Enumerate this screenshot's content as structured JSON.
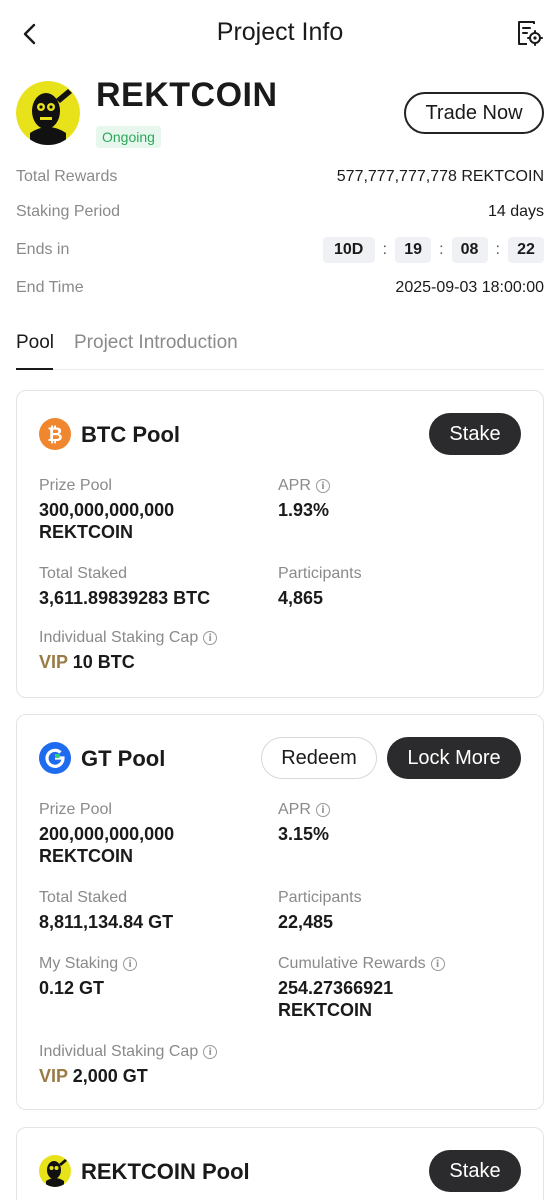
{
  "header": {
    "title": "Project Info"
  },
  "project": {
    "name": "REKTCOIN",
    "status": "Ongoing",
    "trade_button": "Trade Now"
  },
  "info": {
    "total_rewards": {
      "label": "Total Rewards",
      "value": "577,777,777,778 REKTCOIN"
    },
    "staking_period": {
      "label": "Staking Period",
      "value": "14 days"
    },
    "ends_in": {
      "label": "Ends in",
      "days": "10D",
      "hours": "19",
      "minutes": "08",
      "seconds": "22",
      "separator": ":"
    },
    "end_time": {
      "label": "End Time",
      "value": "2025-09-03 18:00:00"
    }
  },
  "tabs": [
    {
      "label": "Pool"
    },
    {
      "label": "Project Introduction"
    }
  ],
  "pools": {
    "btc": {
      "title": "BTC Pool",
      "button": "Stake",
      "prize_pool_label": "Prize Pool",
      "prize_pool_amount": "300,000,000,000",
      "prize_pool_unit": "REKTCOIN",
      "apr_label": "APR",
      "apr_value": "1.93%",
      "total_staked_label": "Total Staked",
      "total_staked_value": "3,611.89839283 BTC",
      "participants_label": "Participants",
      "participants_value": "4,865",
      "cap_label": "Individual Staking Cap",
      "cap_vip": "VIP",
      "cap_value": "10 BTC"
    },
    "gt": {
      "title": "GT Pool",
      "redeem_button": "Redeem",
      "lock_button": "Lock More",
      "prize_pool_label": "Prize Pool",
      "prize_pool_amount": "200,000,000,000",
      "prize_pool_unit": "REKTCOIN",
      "apr_label": "APR",
      "apr_value": "3.15%",
      "total_staked_label": "Total Staked",
      "total_staked_value": "8,811,134.84 GT",
      "participants_label": "Participants",
      "participants_value": "22,485",
      "my_staking_label": "My Staking",
      "my_staking_value": "0.12 GT",
      "cumulative_label": "Cumulative Rewards",
      "cumulative_amount": "254.27366921",
      "cumulative_unit": "REKTCOIN",
      "cap_label": "Individual Staking Cap",
      "cap_vip": "VIP",
      "cap_value": "2,000 GT"
    },
    "rekt": {
      "title": "REKTCOIN Pool",
      "button": "Stake"
    }
  },
  "colors": {
    "btc_orange": "#f0862e",
    "gt_blue": "#1f6bf0",
    "status_green": "#2aa85a",
    "vip_gold": "#9a7a45",
    "button_dark": "#2b2b2d",
    "rekt_yellow": "#e8e21a"
  },
  "icons": {
    "back": "chevron-left-icon",
    "settings": "document-gear-icon",
    "info": "info-circle-icon"
  }
}
